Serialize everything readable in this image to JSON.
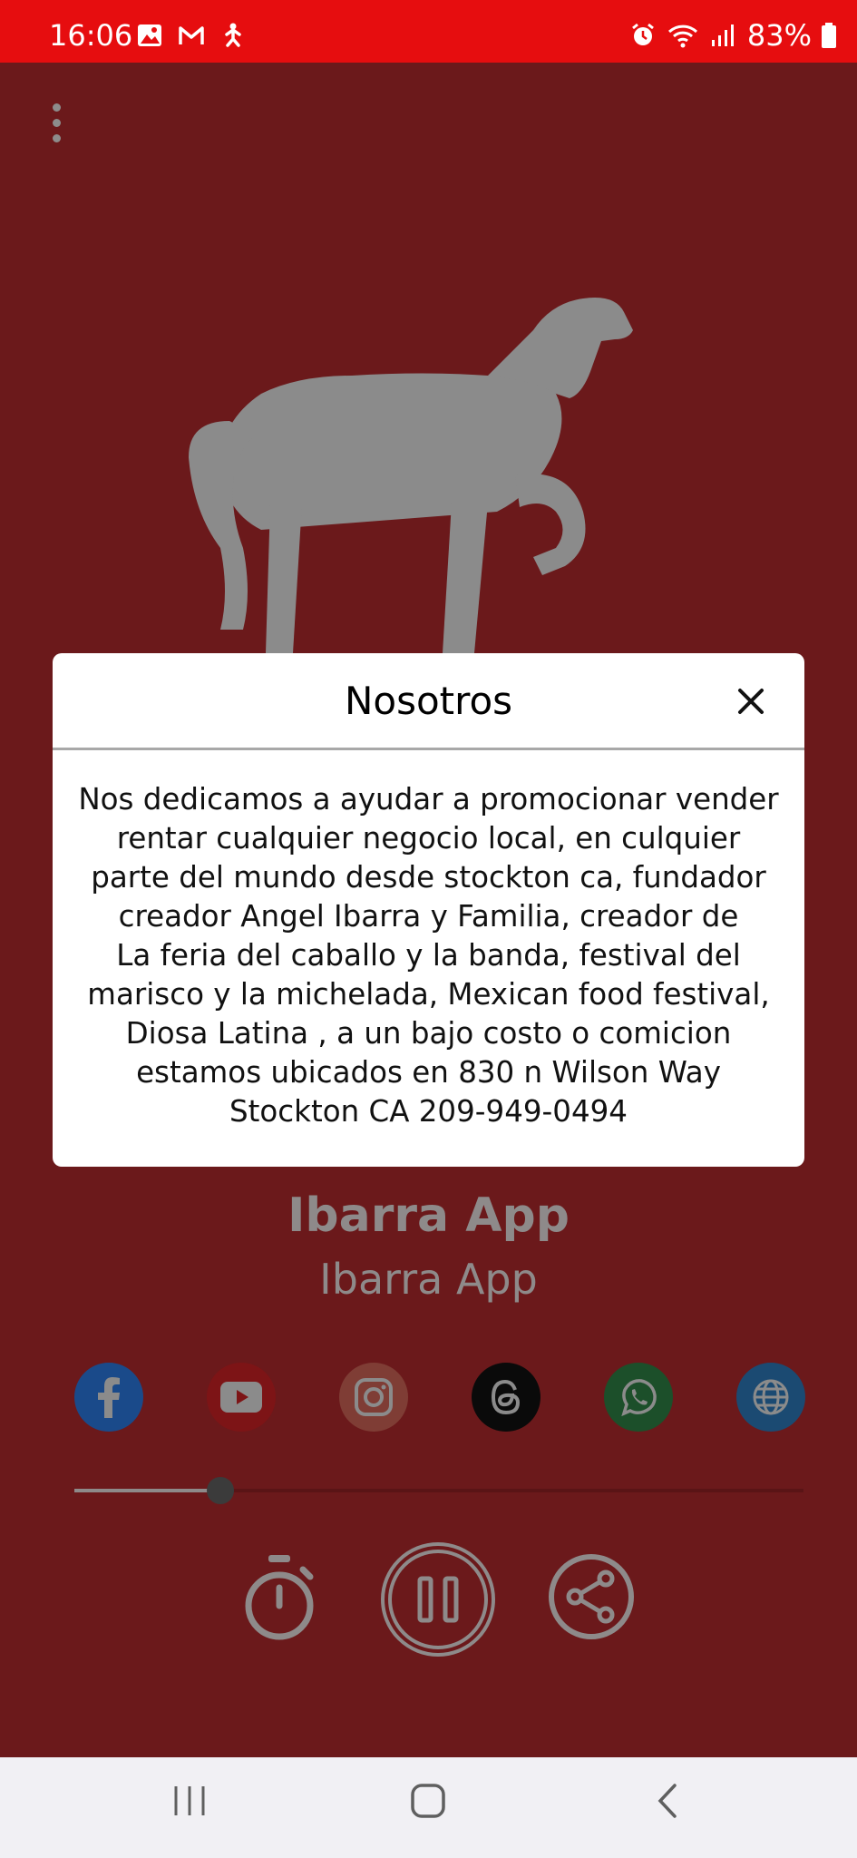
{
  "status_bar": {
    "time": "16:06",
    "battery": "83%",
    "left_icons": [
      "gallery-icon",
      "gmail-icon",
      "accessibility-icon"
    ],
    "right_icons": [
      "alarm-icon",
      "wifi-icon",
      "signal-icon",
      "battery-icon"
    ]
  },
  "player": {
    "title": "Ibarra App",
    "subtitle": "Ibarra App",
    "progress": 0.2,
    "social_links": [
      "facebook",
      "youtube",
      "instagram",
      "threads",
      "whatsapp",
      "website"
    ],
    "controls": [
      "sleep-timer",
      "pause",
      "share"
    ]
  },
  "dialog": {
    "title": "Nosotros",
    "body": "Nos dedicamos a ayudar a promocionar vender\nrentar cualquier negocio local, en culquier\nparte del mundo desde stockton ca, fundador\ncreador Angel Ibarra y Familia, creador de\nLa feria del caballo y la banda, festival del\nmarisco y la michelada, Mexican food festival,\nDiosa Latina , a un bajo costo o comicion\nestamos ubicados en 830 n Wilson Way\nStockton CA 209-949-0494"
  },
  "colors": {
    "status_bar": "#e60d0f",
    "background": "#6b191b",
    "muted_text": "#8e8a8a",
    "dialog_bg": "#ffffff"
  }
}
